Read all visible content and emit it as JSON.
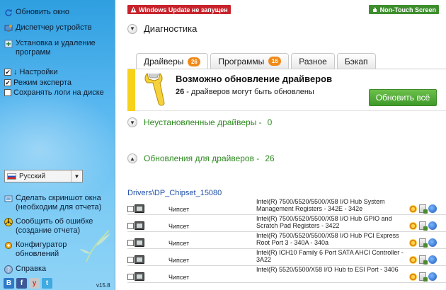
{
  "sidebar": {
    "items": [
      {
        "label": "Обновить окно",
        "icon": "refresh-icon"
      },
      {
        "label": "Диспетчер устройств",
        "icon": "device-manager-icon"
      },
      {
        "label": "Установка и удаление программ",
        "icon": "add-remove-icon"
      }
    ],
    "checks": [
      {
        "label": "↓ Настройки",
        "checked": true
      },
      {
        "label": "Режим эксперта",
        "checked": true
      },
      {
        "label": "Сохранять логи на диске",
        "checked": false
      }
    ],
    "language": "Русский",
    "bottom_items": [
      {
        "label": "Сделать скриншот окна (необходим для отчета)",
        "icon": "screenshot-icon"
      },
      {
        "label": "Сообщить об ошибке (создание отчета)",
        "icon": "report-error-icon"
      },
      {
        "label": "Конфигуратор обновлений",
        "icon": "configurator-icon"
      },
      {
        "label": "Справка",
        "icon": "help-icon"
      }
    ],
    "socials": [
      {
        "letter": "B",
        "color": "#2e7ac8",
        "icon": "blog-icon"
      },
      {
        "letter": "f",
        "color": "#3b5998",
        "icon": "facebook-icon"
      },
      {
        "letter": "y",
        "color": "#c8c8c8",
        "icon": "youtube-icon"
      },
      {
        "letter": "t",
        "color": "#3fa9e0",
        "icon": "twitter-icon"
      }
    ],
    "version": "v15.8"
  },
  "main": {
    "warning_badge": "Windows Update не запущен",
    "touch_badge": "Non-Touch Screen",
    "diagnostics": "Диагностика",
    "tabs": [
      {
        "label": "Драйверы",
        "count": "26",
        "active": true
      },
      {
        "label": "Программы",
        "count": "16",
        "active": false
      },
      {
        "label": "Разное",
        "count": "",
        "active": false
      },
      {
        "label": "Бэкап",
        "count": "",
        "active": false
      }
    ],
    "panel": {
      "title": "Возможно обновление драйверов",
      "count": "26",
      "subtitle": " - драйверов могут быть обновлены",
      "button": "Обновить всё"
    },
    "uninstalled": {
      "label": "Неустановленные драйверы -",
      "count": "0"
    },
    "updates": {
      "label": "Обновления для драйверов -",
      "count": "26"
    },
    "path": "Drivers\\DP_Chipset_15080",
    "rows": [
      {
        "type": "Чипсет",
        "name": "Intel(R) 7500/5520/5500/X58 I/O Hub System Management Registers - 342E - 342e"
      },
      {
        "type": "Чипсет",
        "name": "Intel(R) 7500/5520/5500/X58 I/O Hub GPIO and Scratch Pad Registers - 3422"
      },
      {
        "type": "Чипсет",
        "name": "Intel(R) 7500/5520/5500/X58 I/O Hub PCI Express Root Port 3 - 340A - 340a"
      },
      {
        "type": "Чипсет",
        "name": "Intel(R) ICH10 Family 6 Port SATA AHCI Controller - 3A22"
      },
      {
        "type": "Чипсет",
        "name": "Intel(R) 5520/5500/X58 I/O Hub to ESI Port - 3406"
      }
    ]
  }
}
